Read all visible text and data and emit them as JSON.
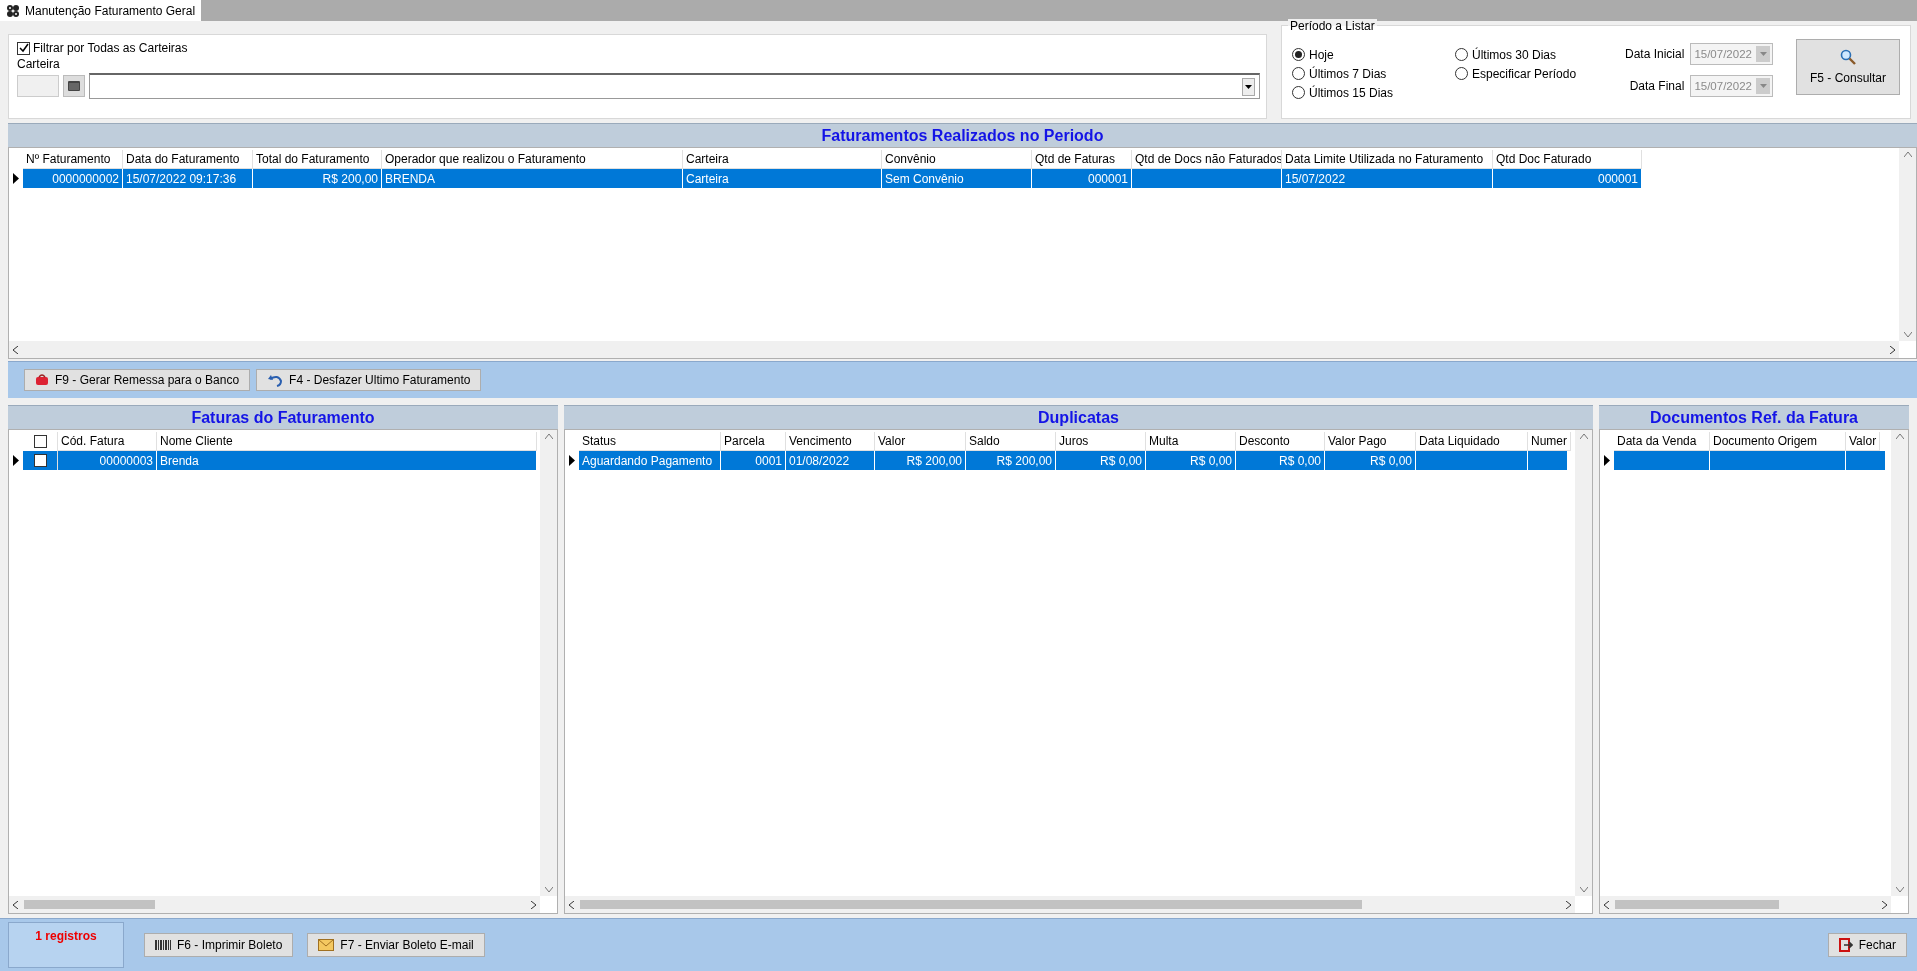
{
  "window": {
    "tab_title": "Manutenção Faturamento Geral"
  },
  "filter": {
    "all_wallets": {
      "label": "Filtrar por Todas as Carteiras",
      "checked": true
    },
    "wallet_label": "Carteira"
  },
  "period": {
    "title": "Período a Listar",
    "options": [
      {
        "label": "Hoje",
        "selected": true
      },
      {
        "label": "Últimos 7 Dias",
        "selected": false
      },
      {
        "label": "Últimos 15 Dias",
        "selected": false
      },
      {
        "label": "Últimos 30 Dias",
        "selected": false
      },
      {
        "label": "Especificar Período",
        "selected": false
      }
    ],
    "start": {
      "label": "Data Inicial",
      "value": "15/07/2022",
      "disabled": true
    },
    "end": {
      "label": "Data Final",
      "value": "15/07/2022",
      "disabled": true
    },
    "consult_button": "F5 - Consultar"
  },
  "billings": {
    "title": "Faturamentos Realizados no Periodo",
    "columns": [
      {
        "label": "Nº Faturamento",
        "kind": "number"
      },
      {
        "label": "Data do Faturamento",
        "kind": "text"
      },
      {
        "label": "Total do Faturamento",
        "kind": "number"
      },
      {
        "label": "Operador que realizou o Faturamento",
        "kind": "text"
      },
      {
        "label": "Carteira",
        "kind": "text"
      },
      {
        "label": "Convênio",
        "kind": "text"
      },
      {
        "label": "Qtd de Faturas",
        "kind": "number"
      },
      {
        "label": "Qtd de Docs não Faturados"
      },
      {
        "label": "Data Limite Utilizada no Faturamento",
        "kind": "text"
      },
      {
        "label": "Qtd Doc Faturado",
        "kind": "number"
      }
    ],
    "rows": [
      {
        "selected": true,
        "cells": [
          "0000000002",
          "15/07/2022 09:17:36",
          "R$ 200,00",
          "BRENDA",
          "Carteira",
          "Sem Convênio",
          "000001",
          null,
          "15/07/2022",
          "000001"
        ]
      }
    ]
  },
  "actions": [
    "F9 - Gerar Remessa para o Banco",
    "F4 - Desfazer Ultimo Faturamento"
  ],
  "invoices": {
    "title": "Faturas do Faturamento",
    "header_checked": false,
    "columns": [
      {
        "label": "Cód. Fatura",
        "kind": "number"
      },
      {
        "label": "Nome Cliente",
        "kind": "text"
      }
    ],
    "rows": [
      {
        "selected": true,
        "checked": false,
        "cells": [
          "00000003",
          "Brenda"
        ]
      }
    ]
  },
  "duplicates": {
    "title": "Duplicatas",
    "columns": [
      {
        "label": "Status",
        "kind": "text"
      },
      {
        "label": "Parcela",
        "kind": "number"
      },
      {
        "label": "Vencimento",
        "kind": "text"
      },
      {
        "label": "Valor",
        "kind": "number"
      },
      {
        "label": "Saldo",
        "kind": "number"
      },
      {
        "label": "Juros",
        "kind": "number"
      },
      {
        "label": "Multa",
        "kind": "number"
      },
      {
        "label": "Desconto",
        "kind": "number"
      },
      {
        "label": "Valor Pago",
        "kind": "number"
      },
      {
        "label": "Data Liquidado"
      },
      {
        "label": "Numer"
      }
    ],
    "rows": [
      {
        "selected": true,
        "cells": [
          "Aguardando Pagamento",
          "0001",
          "01/08/2022",
          "R$ 200,00",
          "R$ 200,00",
          "R$ 0,00",
          "R$ 0,00",
          "R$ 0,00",
          "R$ 0,00",
          null,
          null
        ]
      }
    ]
  },
  "documents": {
    "title": "Documentos Ref. da Fatura",
    "columns": [
      {
        "label": "Data da Venda"
      },
      {
        "label": "Documento Origem"
      },
      {
        "label": "Valor"
      }
    ],
    "rows": [
      {
        "selected": true,
        "cells": [
          null,
          null,
          null
        ]
      }
    ]
  },
  "footer": {
    "count": "1 registros",
    "buttons": [
      "F6 - Imprimir Boleto",
      "F7 - Enviar Boleto E-mail"
    ],
    "close": "Fechar"
  }
}
